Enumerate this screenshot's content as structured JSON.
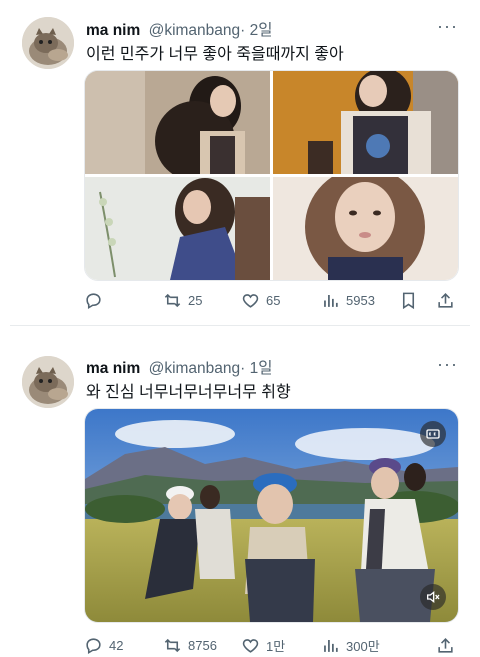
{
  "tweets": [
    {
      "name": "ma nim",
      "handle": "@kimanbang",
      "time": "· 2일",
      "more": "···",
      "text": "이런 민주가 너무 좋아 죽을때까지 좋아",
      "stats": {
        "replies": "",
        "retweets": "25",
        "likes": "65",
        "views": "5953"
      }
    },
    {
      "name": "ma nim",
      "handle": "@kimanbang",
      "time": "· 1일",
      "more": "···",
      "text": "와 진심 너무너무너무너무 취향",
      "stats": {
        "replies": "42",
        "retweets": "8756",
        "likes": "1만",
        "views": "300만"
      }
    }
  ],
  "icons": {
    "reply": "reply-icon",
    "retweet": "retweet-icon",
    "like": "heart-icon",
    "views": "views-chart-icon",
    "bookmark": "bookmark-icon",
    "share": "share-icon",
    "caption": "captions-icon",
    "mute": "mute-icon"
  },
  "colors": {
    "text": "#0f1419",
    "secondary": "#536471",
    "divider": "#e8ebed"
  }
}
